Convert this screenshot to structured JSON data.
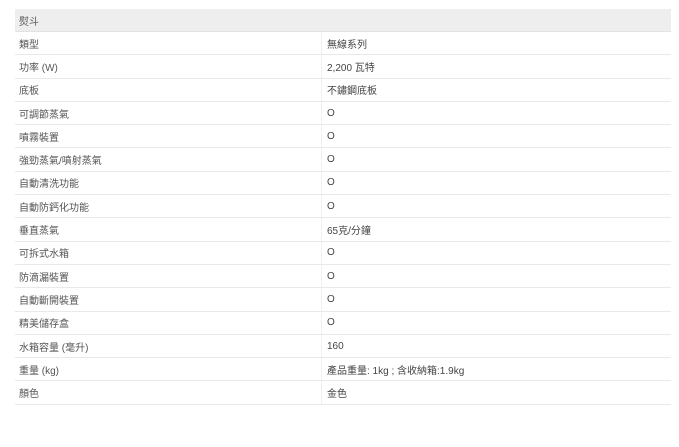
{
  "table": {
    "header": "熨斗",
    "rows": [
      {
        "label": "類型",
        "value": "無線系列"
      },
      {
        "label": "功率 (W)",
        "value": "2,200 瓦特"
      },
      {
        "label": "底板",
        "value": "不鏽鋼底板"
      },
      {
        "label": "可調節蒸氣",
        "value": "O"
      },
      {
        "label": "噴霧裝置",
        "value": "O"
      },
      {
        "label": "強勁蒸氣/噴射蒸氣",
        "value": "O"
      },
      {
        "label": "自動清洗功能",
        "value": "O"
      },
      {
        "label": "自動防鈣化功能",
        "value": "O"
      },
      {
        "label": "垂直蒸氣",
        "value": "65克/分鐘"
      },
      {
        "label": "可拆式水箱",
        "value": "O"
      },
      {
        "label": "防滴漏裝置",
        "value": "O"
      },
      {
        "label": "自動斷開裝置",
        "value": "O"
      },
      {
        "label": "精美儲存盒",
        "value": "O"
      },
      {
        "label": "水箱容量 (毫升)",
        "value": "160"
      },
      {
        "label": "重量 (kg)",
        "value": "產品重量: 1kg ; 含收納箱:1.9kg"
      },
      {
        "label": "顏色",
        "value": "金色"
      }
    ]
  }
}
